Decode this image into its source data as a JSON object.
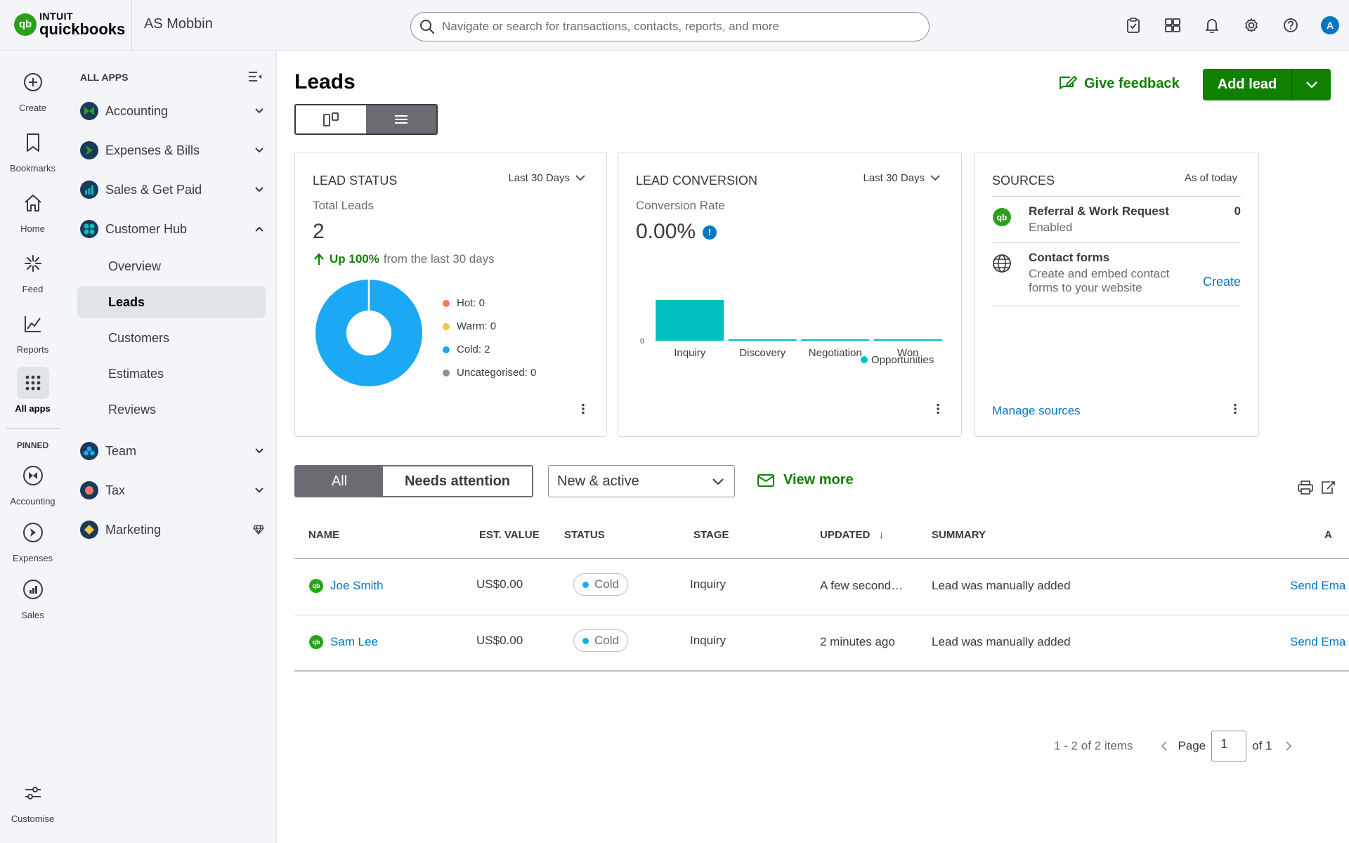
{
  "brand": {
    "intuit": "INTUIT",
    "product": "quickbooks",
    "company": "AS Mobbin"
  },
  "search": {
    "placeholder": "Navigate or search for transactions, contacts, reports, and more"
  },
  "topbar_icons": [
    "clipboard-check-icon",
    "apps-switch-icon",
    "bell-icon",
    "gear-icon",
    "help-icon"
  ],
  "user": {
    "initial": "A"
  },
  "rail": {
    "items": [
      {
        "label": "Create",
        "icon": "plus-circle-icon"
      },
      {
        "label": "Bookmarks",
        "icon": "bookmark-icon"
      },
      {
        "label": "Home",
        "icon": "home-icon"
      },
      {
        "label": "Feed",
        "icon": "feed-icon"
      },
      {
        "label": "Reports",
        "icon": "reports-icon"
      },
      {
        "label": "All apps",
        "icon": "grid-icon"
      }
    ],
    "pinned_label": "PINNED",
    "pinned": [
      {
        "label": "Accounting"
      },
      {
        "label": "Expenses"
      },
      {
        "label": "Sales"
      }
    ],
    "customise": "Customise"
  },
  "apps": {
    "heading": "ALL APPS",
    "items": [
      {
        "label": "Accounting"
      },
      {
        "label": "Expenses & Bills"
      },
      {
        "label": "Sales & Get Paid"
      },
      {
        "label": "Customer Hub"
      }
    ],
    "customer_hub_sub": [
      {
        "label": "Overview"
      },
      {
        "label": "Leads"
      },
      {
        "label": "Customers"
      },
      {
        "label": "Estimates"
      },
      {
        "label": "Reviews"
      }
    ],
    "more": [
      {
        "label": "Team"
      },
      {
        "label": "Tax"
      },
      {
        "label": "Marketing"
      }
    ]
  },
  "page": {
    "title": "Leads",
    "feedback": "Give feedback",
    "add_lead": "Add lead"
  },
  "lead_status": {
    "title": "LEAD STATUS",
    "range": "Last 30 Days",
    "subtitle": "Total Leads",
    "total": "2",
    "change_pct": "Up 100%",
    "change_text": "from the last 30 days",
    "legend": [
      {
        "label": "Hot: 0",
        "color": "#f17a61",
        "value": 0
      },
      {
        "label": "Warm: 0",
        "color": "#f6c344",
        "value": 0
      },
      {
        "label": "Cold: 2",
        "color": "#1ba9f5",
        "value": 2
      },
      {
        "label": "Uncategorised: 0",
        "color": "#8d9096",
        "value": 0
      }
    ]
  },
  "lead_conversion": {
    "title": "LEAD CONVERSION",
    "range": "Last 30 Days",
    "subtitle": "Conversion Rate",
    "rate": "0.00%",
    "info": "!"
  },
  "chart_data": {
    "type": "bar",
    "categories": [
      "Inquiry",
      "Discovery",
      "Negotiation",
      "Won"
    ],
    "series": [
      {
        "name": "Opportunities",
        "values": [
          2,
          0,
          0,
          0
        ],
        "color": "#00c1bf"
      }
    ],
    "ytick": "0",
    "legend": "bottom-right"
  },
  "sources": {
    "title": "SOURCES",
    "as_of": "As of today",
    "items": [
      {
        "title": "Referral & Work Request",
        "desc": "Enabled",
        "value": "0",
        "icon": "quickbooks-icon"
      },
      {
        "title": "Contact forms",
        "desc": "Create and embed contact forms to your website",
        "link": "Create",
        "icon": "globe-icon"
      }
    ],
    "manage": "Manage sources"
  },
  "filters": {
    "tabs": [
      "All",
      "Needs attention"
    ],
    "select_value": "New & active",
    "view_more": "View more"
  },
  "table": {
    "headers": [
      "NAME",
      "EST. VALUE",
      "STATUS",
      "STAGE",
      "UPDATED",
      "SUMMARY",
      "A"
    ],
    "sort_indicator": "↓",
    "rows": [
      {
        "name": "Joe Smith",
        "value": "US$0.00",
        "status": "Cold",
        "stage": "Inquiry",
        "updated": "A few second…",
        "summary": "Lead was manually added",
        "action": "Send Ema"
      },
      {
        "name": "Sam Lee",
        "value": "US$0.00",
        "status": "Cold",
        "stage": "Inquiry",
        "updated": "2 minutes ago",
        "summary": "Lead was manually added",
        "action": "Send Ema"
      }
    ]
  },
  "pager": {
    "range": "1 - 2 of 2 items",
    "page_label": "Page",
    "page": "1",
    "of": "of 1"
  }
}
